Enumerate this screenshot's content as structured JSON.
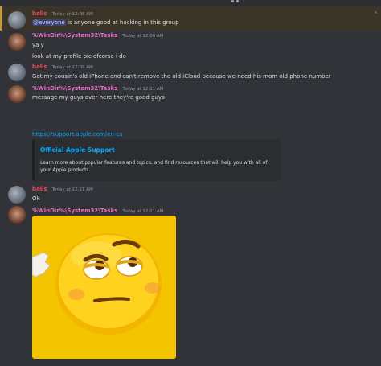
{
  "messages": [
    {
      "author": "balls",
      "timestamp": "Today at 12:08 AM",
      "mention": "@everyone",
      "text": " is anyone good at hacking in this group"
    },
    {
      "author": "%WinDir%\\System32\\Tasks",
      "timestamp": "Today at 12:08 AM",
      "lines": [
        "ya y",
        "look at my profile pic ofcorse i do"
      ]
    },
    {
      "author": "balls",
      "timestamp": "Today at 12:09 AM",
      "text": "Got my cousin's old iPhone and can't remove the old iCloud because we need his mom old phone number"
    },
    {
      "author": "%WinDir%\\System32\\Tasks",
      "timestamp": "Today at 12:11 AM",
      "text": "message my guys over here they're good guys",
      "link": "https://support.apple.com/en-ca",
      "embed": {
        "title": "Official Apple Support",
        "description": "Learn more about popular features and topics, and find resources that will help you with all of your Apple products."
      }
    },
    {
      "author": "balls",
      "timestamp": "Today at 12:11 AM",
      "text": "Ok"
    },
    {
      "author": "%WinDir%\\System32\\Tasks",
      "timestamp": "Today at 12:11 AM"
    }
  ],
  "colors": {
    "balls": "#e84c5a",
    "tasks": "#ea6ec3",
    "link": "#00a8fc",
    "background": "#313338"
  },
  "icons": {
    "gif": "unimpressed-emoji-gif"
  }
}
